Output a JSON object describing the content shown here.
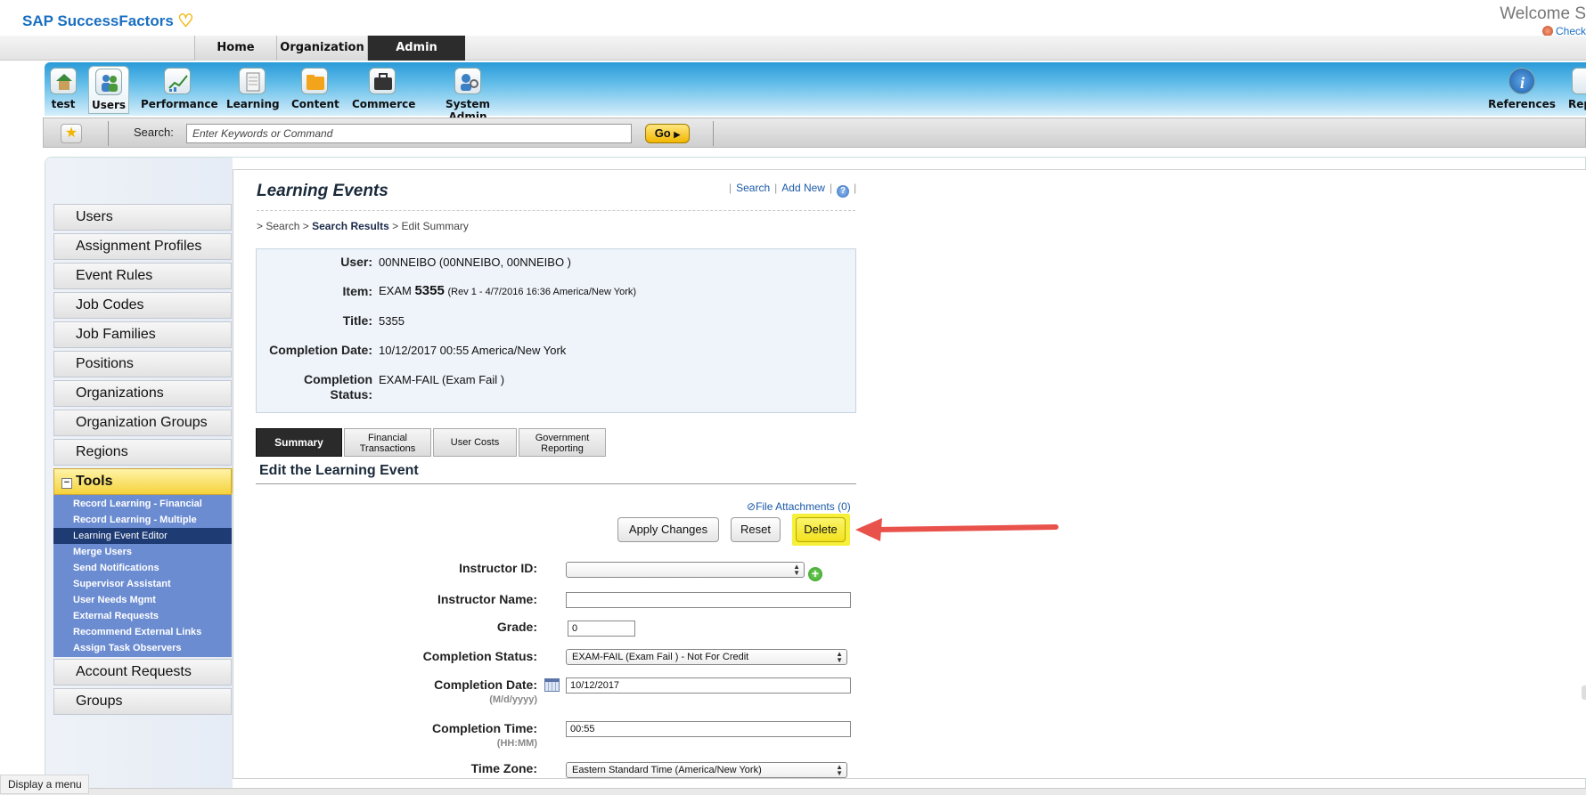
{
  "brand": {
    "name": "SAP SuccessFactors",
    "welcome": "Welcome S",
    "check_link": "Check"
  },
  "top_tabs": [
    "Home",
    "Organization",
    "Admin"
  ],
  "modules": {
    "left": [
      "test",
      "Users",
      "Performance",
      "Learning",
      "Content",
      "Commerce",
      "System Admin"
    ],
    "right": [
      "References",
      "Rep"
    ]
  },
  "search": {
    "label": "Search:",
    "placeholder": "Enter Keywords or Command",
    "go": "Go"
  },
  "sidebar": {
    "items_top": [
      "Users",
      "Assignment Profiles",
      "Event Rules",
      "Job Codes",
      "Job Families",
      "Positions",
      "Organizations",
      "Organization Groups",
      "Regions"
    ],
    "tools_label": "Tools",
    "tools_items": [
      "Record Learning - Financial",
      "Record Learning - Multiple",
      "Learning Event Editor",
      "Merge Users",
      "Send Notifications",
      "Supervisor Assistant",
      "User Needs Mgmt",
      "External Requests",
      "Recommend External Links",
      "Assign Task Observers"
    ],
    "items_bottom": [
      "Account Requests",
      "Groups"
    ]
  },
  "page": {
    "title": "Learning Events",
    "links": {
      "search": "Search",
      "add_new": "Add New",
      "help": "?"
    },
    "breadcrumb": {
      "sep": ">",
      "search": "Search",
      "results": "Search Results",
      "current": "Edit Summary"
    }
  },
  "summary": {
    "user_label": "User:",
    "user": "00NNEIBO (00NNEIBO, 00NNEIBO )",
    "item_label": "Item:",
    "item_prefix": "EXAM",
    "item_id": "5355",
    "item_rev": "(Rev 1 - 4/7/2016 16:36 America/New York)",
    "title_label": "Title:",
    "title": "5355",
    "completion_date_label": "Completion Date:",
    "completion_date": "10/12/2017 00:55 America/New York",
    "completion_status_label_1": "Completion",
    "completion_status_label_2": "Status:",
    "completion_status": "EXAM-FAIL (Exam Fail )"
  },
  "tabs": [
    {
      "line1": "Summary",
      "line2": ""
    },
    {
      "line1": "Financial",
      "line2": "Transactions"
    },
    {
      "line1": "User Costs",
      "line2": ""
    },
    {
      "line1": "Government",
      "line2": "Reporting"
    }
  ],
  "edit": {
    "heading": "Edit the Learning Event",
    "attachments": "File Attachments (0)",
    "buttons": {
      "apply": "Apply Changes",
      "reset": "Reset",
      "delete": "Delete"
    }
  },
  "form": {
    "instructor_id_label": "Instructor ID:",
    "instructor_id": "",
    "instructor_name_label": "Instructor Name:",
    "instructor_name": "",
    "grade_label": "Grade:",
    "grade": "0",
    "completion_status_label": "Completion Status:",
    "completion_status": "EXAM-FAIL (Exam Fail ) - Not For Credit",
    "completion_date_label": "Completion Date:",
    "completion_date_hint": "(M/d/yyyy)",
    "completion_date": "10/12/2017",
    "completion_time_label": "Completion Time:",
    "completion_time_hint": "(HH:MM)",
    "completion_time": "00:55",
    "time_zone_label": "Time Zone:",
    "time_zone": "Eastern Standard Time (America/New York)"
  },
  "tooltip": "Display a menu",
  "colors": {
    "brand_blue": "#1a6fc1",
    "accent_yellow": "#f7f03a",
    "annotation_red": "#e9514b",
    "nav_blue": "#6b8cd1"
  }
}
